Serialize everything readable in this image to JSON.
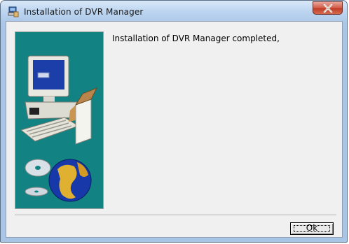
{
  "window": {
    "title": "Installation of DVR Manager"
  },
  "icons": {
    "app": "installer-icon",
    "close": "close-icon",
    "banner": "computer-and-globe-illustration"
  },
  "content": {
    "message": "Installation of DVR Manager completed,"
  },
  "buttons": {
    "ok_label": "Ok"
  },
  "colors": {
    "banner_background": "#128283",
    "close_button": "#c13e27"
  }
}
